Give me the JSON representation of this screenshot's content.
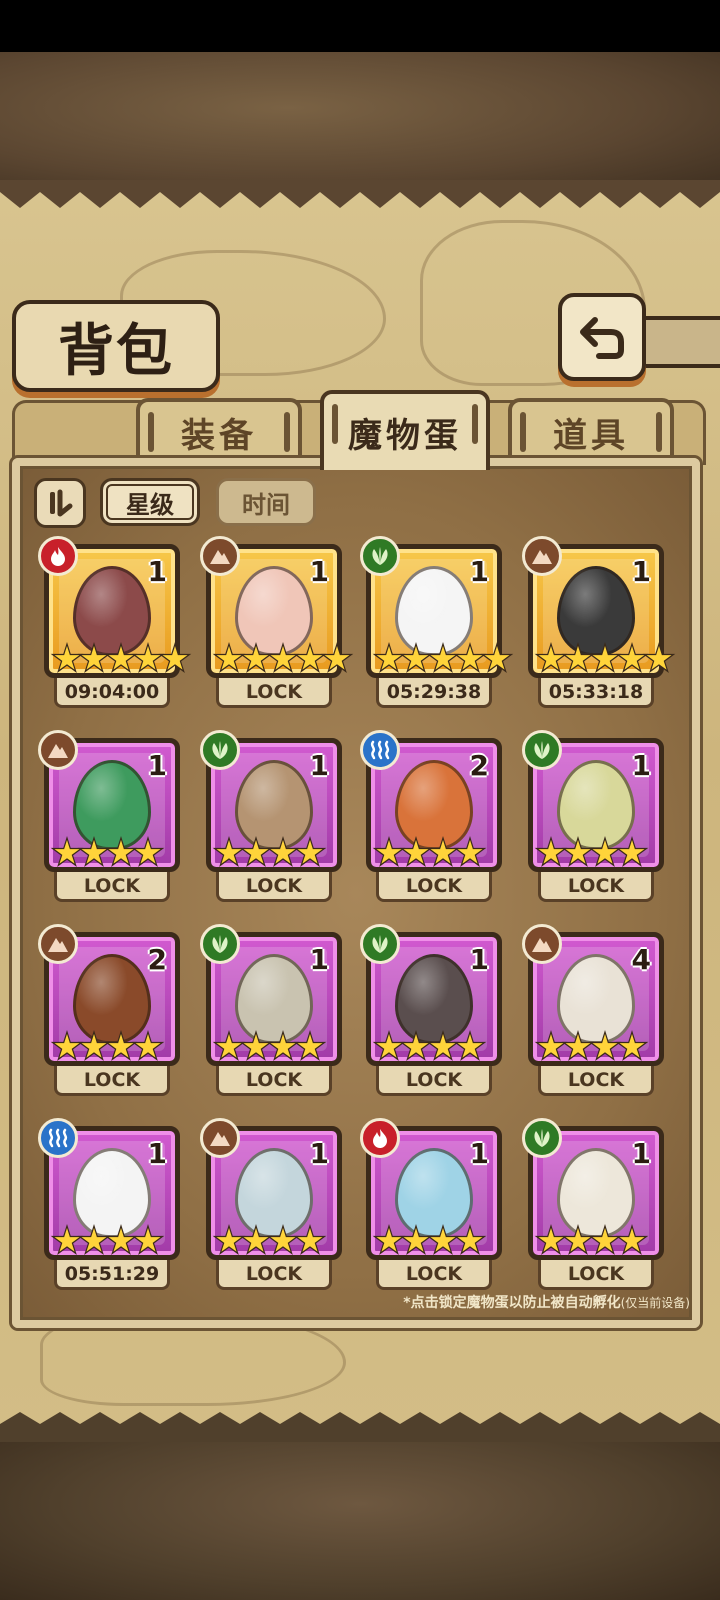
{
  "page": {
    "title": "背包"
  },
  "tabs": [
    {
      "label": "装备",
      "active": false
    },
    {
      "label": "魔物蛋",
      "active": true
    },
    {
      "label": "道具",
      "active": false
    }
  ],
  "sort": {
    "toggle_icon": "sort-order-icon",
    "options": [
      {
        "label": "星级",
        "active": true
      },
      {
        "label": "时间",
        "active": false
      }
    ]
  },
  "eggs": [
    {
      "element": "fire",
      "count": "1",
      "stars": 5,
      "rarity": "gold",
      "status": "09:04:00",
      "art_color": "#8c4a4a"
    },
    {
      "element": "earth",
      "count": "1",
      "stars": 5,
      "rarity": "gold",
      "status": "LOCK",
      "art_color": "#f0c6b8"
    },
    {
      "element": "grass",
      "count": "1",
      "stars": 5,
      "rarity": "gold",
      "status": "05:29:38",
      "art_color": "#f5f5f5"
    },
    {
      "element": "earth",
      "count": "1",
      "stars": 5,
      "rarity": "gold",
      "status": "05:33:18",
      "art_color": "#3a3a3a"
    },
    {
      "element": "earth",
      "count": "1",
      "stars": 4,
      "rarity": "purple",
      "status": "LOCK",
      "art_color": "#3e9b5e"
    },
    {
      "element": "grass",
      "count": "1",
      "stars": 4,
      "rarity": "purple",
      "status": "LOCK",
      "art_color": "#b59472"
    },
    {
      "element": "water",
      "count": "2",
      "stars": 4,
      "rarity": "purple",
      "status": "LOCK",
      "art_color": "#d9733a"
    },
    {
      "element": "grass",
      "count": "1",
      "stars": 4,
      "rarity": "purple",
      "status": "LOCK",
      "art_color": "#d8d89a"
    },
    {
      "element": "earth",
      "count": "2",
      "stars": 4,
      "rarity": "purple",
      "status": "LOCK",
      "art_color": "#8a4a2a"
    },
    {
      "element": "grass",
      "count": "1",
      "stars": 4,
      "rarity": "purple",
      "status": "LOCK",
      "art_color": "#c9c3b0"
    },
    {
      "element": "grass",
      "count": "1",
      "stars": 4,
      "rarity": "purple",
      "status": "LOCK",
      "art_color": "#5a4e4e"
    },
    {
      "element": "earth",
      "count": "4",
      "stars": 4,
      "rarity": "purple",
      "status": "LOCK",
      "art_color": "#e9e2d6"
    },
    {
      "element": "water",
      "count": "1",
      "stars": 4,
      "rarity": "purple",
      "status": "05:51:29",
      "art_color": "#f4f4f4"
    },
    {
      "element": "earth",
      "count": "1",
      "stars": 4,
      "rarity": "purple",
      "status": "LOCK",
      "art_color": "#c4d6dc"
    },
    {
      "element": "fire",
      "count": "1",
      "stars": 4,
      "rarity": "purple",
      "status": "LOCK",
      "art_color": "#9fd3e6"
    },
    {
      "element": "grass",
      "count": "1",
      "stars": 4,
      "rarity": "purple",
      "status": "LOCK",
      "art_color": "#ede7da"
    }
  ],
  "footer_note": "*点击锁定魔物蛋以防止被自动孵化",
  "footer_note_suffix": "(仅当前设备)",
  "back_icon": "back-arrow-icon",
  "colors": {
    "gold_frame": "#f0b030",
    "purple_frame": "#c04ac0",
    "fire": "#c8202a",
    "earth": "#7d4a2c",
    "grass": "#2f7a25",
    "water": "#2a73c9"
  }
}
